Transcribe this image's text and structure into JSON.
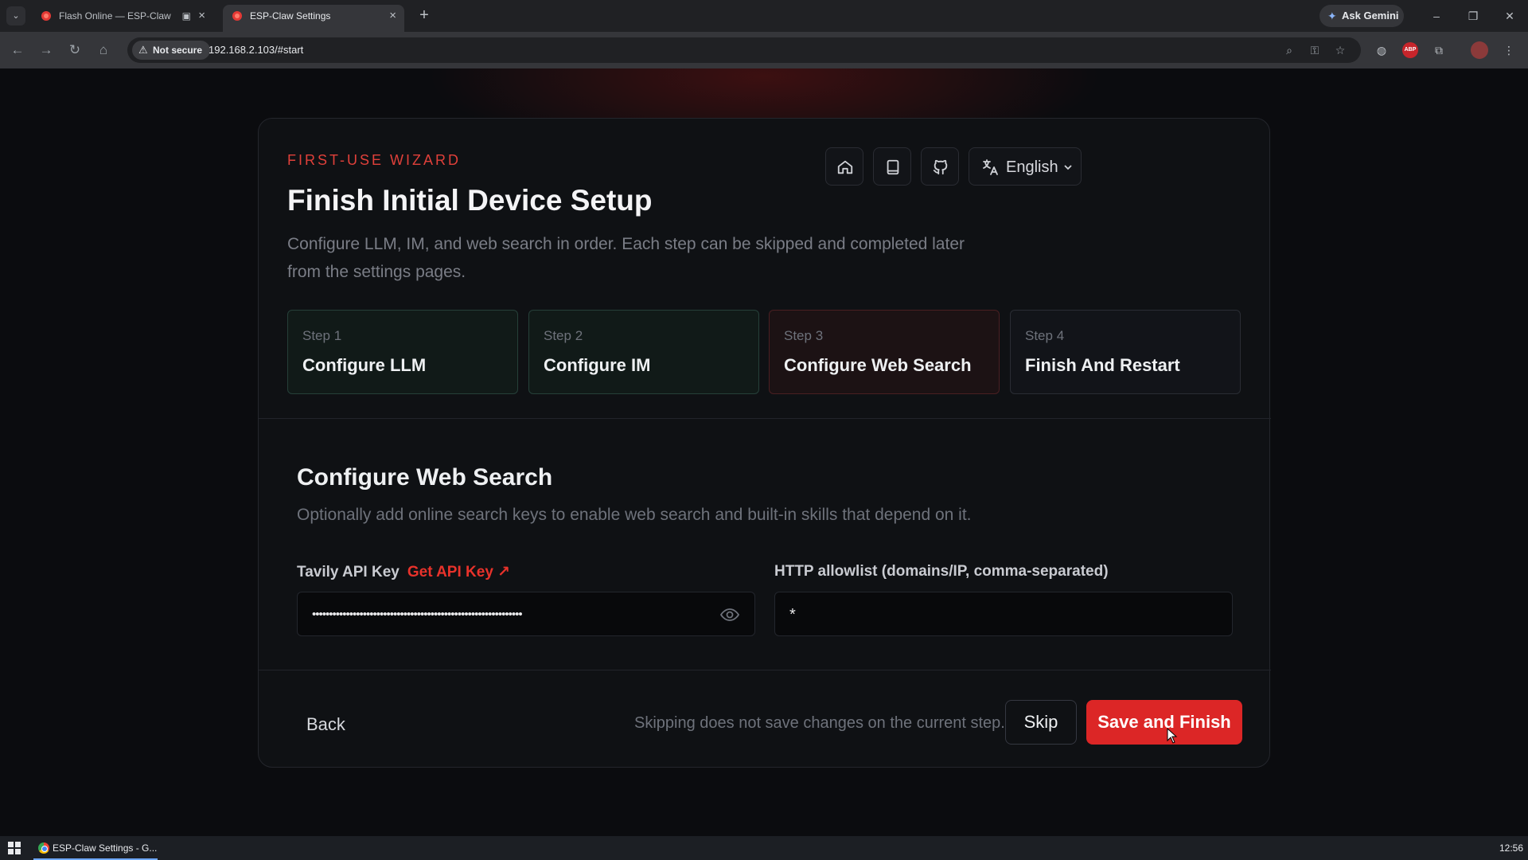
{
  "browser": {
    "tabs": [
      {
        "title": "Flash Online — ESP-Claw"
      },
      {
        "title": "ESP-Claw Settings"
      }
    ],
    "ask_gemini": "Ask Gemini",
    "security_label": "Not secure",
    "url": "192.168.2.103/#start"
  },
  "wizard": {
    "eyebrow": "FIRST-USE WIZARD",
    "title": "Finish Initial Device Setup",
    "subtitle": "Configure LLM, IM, and web search in order. Each step can be skipped and completed later from the settings pages.",
    "language": "English",
    "steps": [
      {
        "num": "Step 1",
        "title": "Configure LLM",
        "state": "done"
      },
      {
        "num": "Step 2",
        "title": "Configure IM",
        "state": "done"
      },
      {
        "num": "Step 3",
        "title": "Configure Web Search",
        "state": "active"
      },
      {
        "num": "Step 4",
        "title": "Finish And Restart",
        "state": "pending"
      }
    ]
  },
  "section": {
    "title": "Configure Web Search",
    "subtitle": "Optionally add online search keys to enable web search and built-in skills that depend on it.",
    "tavily_label": "Tavily API Key",
    "tavily_link": "Get API Key ↗",
    "tavily_value": "••••••••••••••••••••••••••••••••••••••••••••••••••••••••••••••",
    "allowlist_label": "HTTP allowlist (domains/IP, comma-separated)",
    "allowlist_value": "*"
  },
  "footer": {
    "back": "Back",
    "skip_note": "Skipping does not save changes on the current step.",
    "skip": "Skip",
    "save": "Save and Finish"
  },
  "taskbar": {
    "app": "ESP-Claw Settings - G...",
    "clock": "12:56"
  },
  "colors": {
    "accent": "#dc2626",
    "done_bg": "#111a18",
    "active_bg": "#1c1214"
  }
}
